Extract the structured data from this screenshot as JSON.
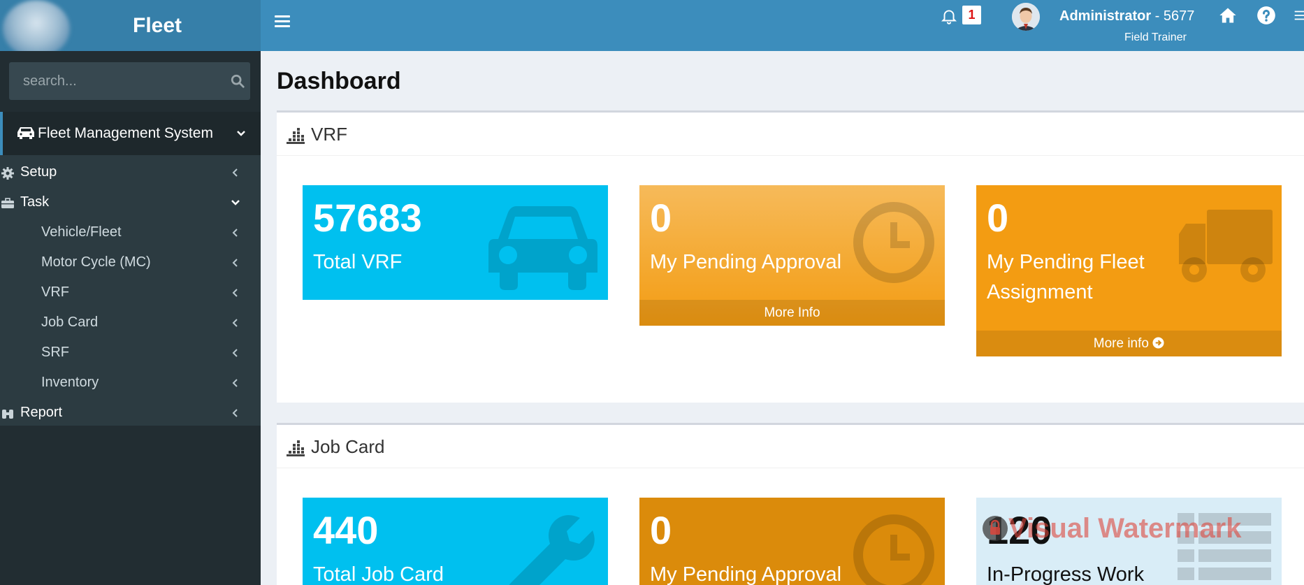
{
  "app": {
    "logo_text": "Fleet"
  },
  "header": {
    "notification_count": "1",
    "user_name": "Administrator",
    "user_id": " - 5677",
    "user_role": "Field Trainer"
  },
  "sidebar": {
    "search_placeholder": "search...",
    "system_label": "Fleet Management System",
    "items": [
      {
        "label": "Setup"
      },
      {
        "label": "Task"
      },
      {
        "label": "Vehicle/Fleet"
      },
      {
        "label": "Motor Cycle (MC)"
      },
      {
        "label": "VRF"
      },
      {
        "label": "Job Card"
      },
      {
        "label": "SRF"
      },
      {
        "label": "Inventory"
      },
      {
        "label": "Report"
      }
    ]
  },
  "main": {
    "page_title": "Dashboard",
    "sections": [
      {
        "title": "VRF",
        "tiles": [
          {
            "number": "57683",
            "label": "Total VRF"
          },
          {
            "number": "0",
            "label": "My Pending Approval",
            "footer": "More Info"
          },
          {
            "number": "0",
            "label": "My Pending Fleet Assignment",
            "footer": "More info"
          }
        ]
      },
      {
        "title": "Job Card",
        "tiles": [
          {
            "number": "440",
            "label": "Total Job Card"
          },
          {
            "number": "0",
            "label": "My Pending Approval"
          },
          {
            "number": "120",
            "label": "In-Progress Work"
          }
        ]
      }
    ],
    "watermark": "Visual Watermark"
  },
  "colors": {
    "header": "#3c8dbc",
    "logo_bg": "#367fa9",
    "sidebar": "#222d32",
    "aqua": "#00c0ef",
    "orange": "#f39c12",
    "light_blue": "#d9edf7"
  }
}
